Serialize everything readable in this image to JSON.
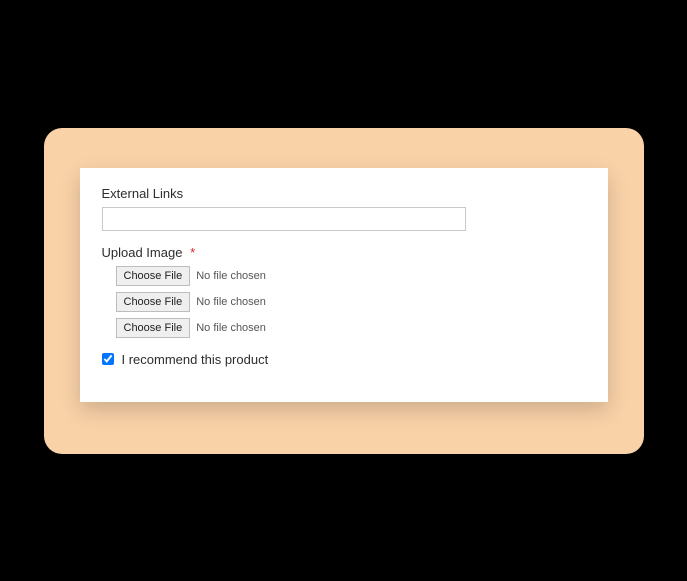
{
  "form": {
    "external_links_label": "External Links",
    "external_links_value": "",
    "upload_image_label": "Upload Image",
    "required_mark": "*",
    "file_inputs": [
      {
        "button_label": "Choose File",
        "status": "No file chosen"
      },
      {
        "button_label": "Choose File",
        "status": "No file chosen"
      },
      {
        "button_label": "Choose File",
        "status": "No file chosen"
      }
    ],
    "recommend_checked": true,
    "recommend_label": "I recommend this product"
  }
}
